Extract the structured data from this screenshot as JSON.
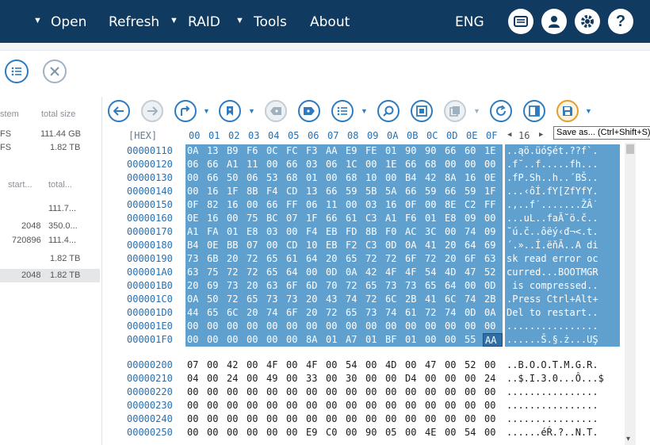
{
  "menu": {
    "open": "Open",
    "refresh": "Refresh",
    "raid": "RAID",
    "tools": "Tools",
    "about": "About",
    "lang": "ENG"
  },
  "left_panel": {
    "col1": "stem",
    "col2": "total size",
    "rows1": [
      {
        "a": "FS",
        "b": "111.44 GB"
      },
      {
        "a": "FS",
        "b": "1.82 TB"
      }
    ],
    "col3": "start...",
    "col4": "total...",
    "rows2": [
      {
        "a": "",
        "b": "111.7..."
      },
      {
        "a": "2048",
        "b": "350.0..."
      },
      {
        "a": "720896",
        "b": "111.4..."
      },
      {
        "a": "",
        "b": "1.82 TB"
      },
      {
        "a": "2048",
        "b": "1.82 TB"
      }
    ]
  },
  "tooltip": "Save as... (Ctrl+Shift+S)",
  "hex": {
    "header_label": "[HEX]",
    "columns": [
      "00",
      "01",
      "02",
      "03",
      "04",
      "05",
      "06",
      "07",
      "08",
      "09",
      "0A",
      "0B",
      "0C",
      "0D",
      "0E",
      "0F"
    ],
    "width_value": "16",
    "rows": [
      {
        "addr": "00000110",
        "bytes": "0A 13 B9 F6 0C FC F3 AA E9 FE 01 90 90 66 60 1E",
        "ascii": "..ąö.üóŞét.??f`."
      },
      {
        "addr": "00000120",
        "bytes": "06 66 A1 11 00 66 03 06 1C 00 1E 66 68 00 00 00",
        "ascii": ".f˘..f.....fh..."
      },
      {
        "addr": "00000130",
        "bytes": "00 66 50 06 53 68 01 00 68 10 00 B4 42 8A 16 0E",
        "ascii": ".fP.Sh..h..´BŠ.."
      },
      {
        "addr": "00000140",
        "bytes": "00 16 1F 8B F4 CD 13 66 59 5B 5A 66 59 66 59 1F",
        "ascii": "...‹ôÍ.fY[ZfYfY."
      },
      {
        "addr": "00000150",
        "bytes": "0F 82 16 00 66 FF 06 11 00 03 16 0F 00 8E C2 FF",
        "ascii": ".‚..f˙.......ŽÂ˙"
      },
      {
        "addr": "00000160",
        "bytes": "0E 16 00 75 BC 07 1F 66 61 C3 A1 F6 01 E8 09 00",
        "ascii": "...uL..faĂ˘ö.č.."
      },
      {
        "addr": "00000170",
        "bytes": "A1 FA 01 E8 03 00 F4 EB FD 8B F0 AC 3C 00 74 09",
        "ascii": "˘ú.č..ôëý‹đ¬<.t."
      },
      {
        "addr": "00000180",
        "bytes": "B4 0E BB 07 00 CD 10 EB F2 C3 0D 0A 41 20 64 69",
        "ascii": "´.»..Í.ëňĂ..A di"
      },
      {
        "addr": "00000190",
        "bytes": "73 6B 20 72 65 61 64 20 65 72 72 6F 72 20 6F 63",
        "ascii": "sk read error oc"
      },
      {
        "addr": "000001A0",
        "bytes": "63 75 72 72 65 64 00 0D 0A 42 4F 4F 54 4D 47 52",
        "ascii": "curred...BOOTMGR"
      },
      {
        "addr": "000001B0",
        "bytes": "20 69 73 20 63 6F 6D 70 72 65 73 73 65 64 00 0D",
        "ascii": " is compressed.."
      },
      {
        "addr": "000001C0",
        "bytes": "0A 50 72 65 73 73 20 43 74 72 6C 2B 41 6C 74 2B",
        "ascii": ".Press Ctrl+Alt+"
      },
      {
        "addr": "000001D0",
        "bytes": "44 65 6C 20 74 6F 20 72 65 73 74 61 72 74 0D 0A",
        "ascii": "Del to restart.."
      },
      {
        "addr": "000001E0",
        "bytes": "00 00 00 00 00 00 00 00 00 00 00 00 00 00 00 00",
        "ascii": "................"
      },
      {
        "addr": "000001F0",
        "bytes": "00 00 00 00 00 00 8A 01 A7 01 BF 01 00 00 55 AA",
        "ascii": "......Š.§.ż...UŞ"
      },
      {
        "addr": "00000200",
        "bytes": "07 00 42 00 4F 00 4F 00 54 00 4D 00 47 00 52 00",
        "ascii": "..B.O.O.T.M.G.R."
      },
      {
        "addr": "00000210",
        "bytes": "04 00 24 00 49 00 33 00 30 00 00 D4 00 00 00 24",
        "ascii": "..$.I.3.0...Ô...$"
      },
      {
        "addr": "00000220",
        "bytes": "00 00 00 00 00 00 00 00 00 00 00 00 00 00 00 00",
        "ascii": "................"
      },
      {
        "addr": "00000230",
        "bytes": "00 00 00 00 00 00 00 00 00 00 00 00 00 00 00 00",
        "ascii": "................"
      },
      {
        "addr": "00000240",
        "bytes": "00 00 00 00 00 00 00 00 00 00 00 00 00 00 00 00",
        "ascii": "................"
      },
      {
        "addr": "00000250",
        "bytes": "00 00 00 00 00 00 E9 C0 00 90 05 00 4E 00 54 00",
        "ascii": "......éŔ.?..N.T."
      }
    ]
  },
  "colors": {
    "topbar": "#103a5f",
    "accent": "#2e7bbf",
    "selection": "#5fa0cf"
  }
}
